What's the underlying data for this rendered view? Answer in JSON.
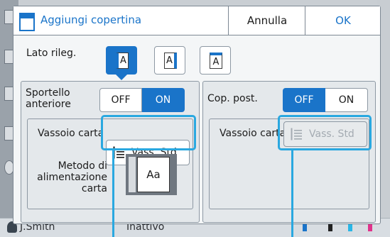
{
  "dialog": {
    "title": "Aggiungi copertina",
    "cancel_label": "Annulla",
    "ok_label": "OK"
  },
  "binding": {
    "label": "Lato rileg.",
    "options": [
      {
        "glyph": "A",
        "kind": "left",
        "selected": true
      },
      {
        "glyph": "A",
        "kind": "right",
        "selected": false
      },
      {
        "glyph": "A",
        "kind": "top",
        "selected": false
      }
    ]
  },
  "front_cover": {
    "label_line1": "Sportello",
    "label_line2": "anteriore",
    "off_label": "OFF",
    "on_label": "ON",
    "selected": "ON",
    "tray_label": "Vassoio carta",
    "tray_value": "Vass. Std",
    "feed_label_line1": "Metodo di",
    "feed_label_line2": "alimentazione",
    "feed_label_line3": "carta",
    "feed_glyph": "Aa"
  },
  "back_cover": {
    "label": "Cop. post.",
    "off_label": "OFF",
    "on_label": "ON",
    "selected": "OFF",
    "tray_label": "Vassoio carta",
    "tray_value": "Vass. Std",
    "tray_enabled": false
  },
  "status_bar": {
    "user": "J.Smith",
    "state": "Inattivo"
  },
  "colors": {
    "accent": "#1a74c9",
    "highlight": "#2aa8e0"
  }
}
